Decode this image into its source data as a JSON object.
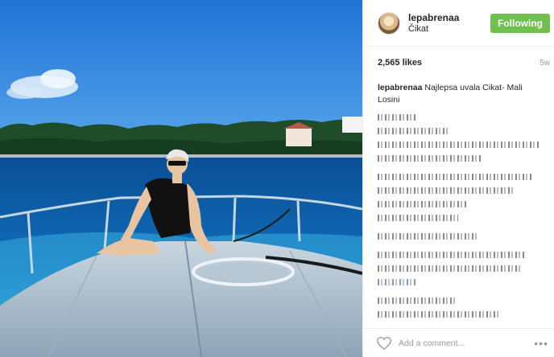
{
  "post": {
    "username": "lepabrenaa",
    "location": "Čikat",
    "follow_label": "Following",
    "likes": "2,565 likes",
    "age": "5w",
    "caption_user": "lepabrenaa",
    "caption_text": "Najlepsa uvala Cikat- Mali Losini"
  },
  "footer": {
    "comment_placeholder": "Add a comment...",
    "more_label": "•••"
  },
  "colors": {
    "follow_button": "#70c050",
    "border": "#efefef"
  },
  "icons": {
    "like": "heart-outline-icon",
    "more": "ellipsis-icon"
  }
}
